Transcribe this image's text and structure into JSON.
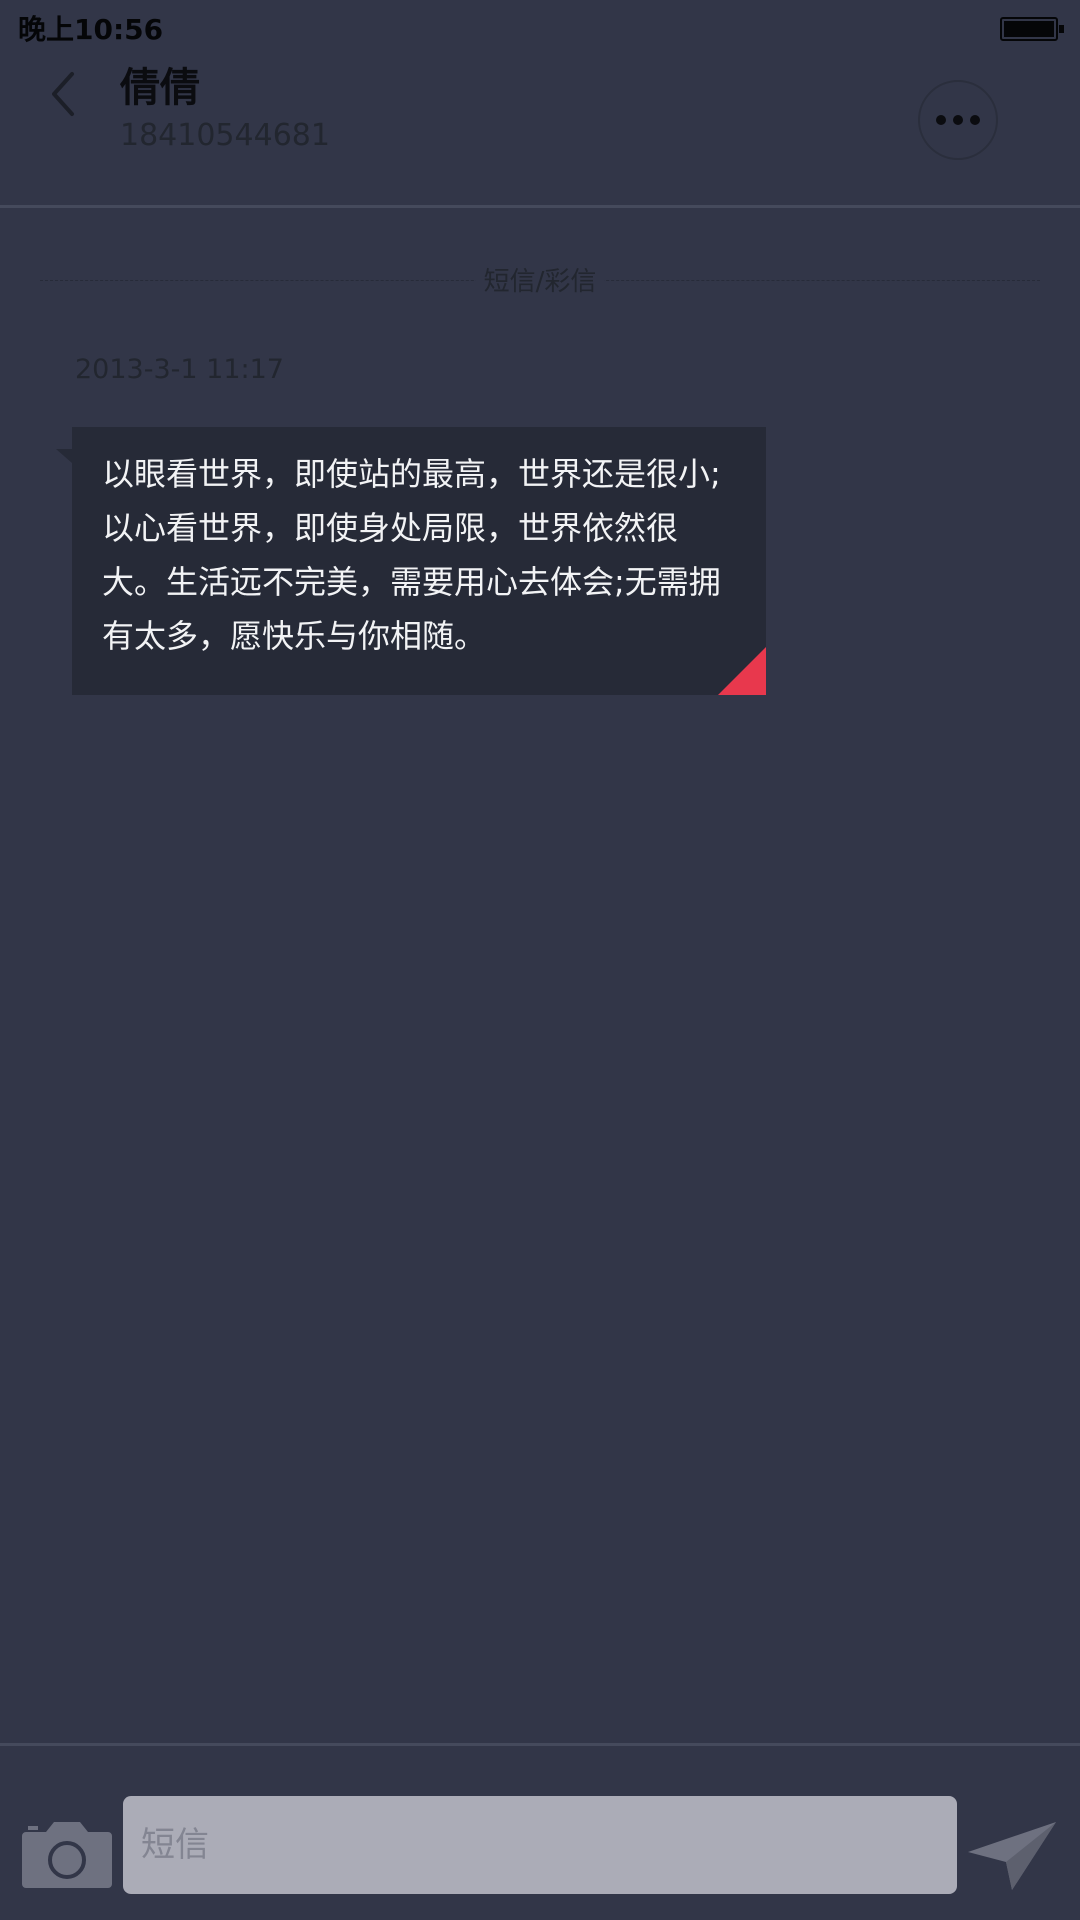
{
  "status_bar": {
    "time": "晚上10:56",
    "battery_level": 1.0
  },
  "header": {
    "contact_name": "倩倩",
    "contact_number": "18410544681"
  },
  "thread": {
    "channel_label": "短信/彩信",
    "messages": [
      {
        "timestamp": "2013-3-1 11:17",
        "text": "以眼看世界，即使站的最高，世界还是很小;以心看世界，即使身处局限，世界依然很大。生活远不完美，需要用心去体会;无需拥有太多，愿快乐与你相随。"
      }
    ]
  },
  "input_bar": {
    "placeholder": "短信",
    "value": ""
  },
  "icons": {
    "back": "chevron-left-icon",
    "more": "more-dots-icon",
    "camera": "camera-icon",
    "send": "paper-plane-icon"
  },
  "colors": {
    "background": "#323648",
    "bubble": "#262a37",
    "accent": "#e8384d",
    "input_field": "#abacb7"
  }
}
